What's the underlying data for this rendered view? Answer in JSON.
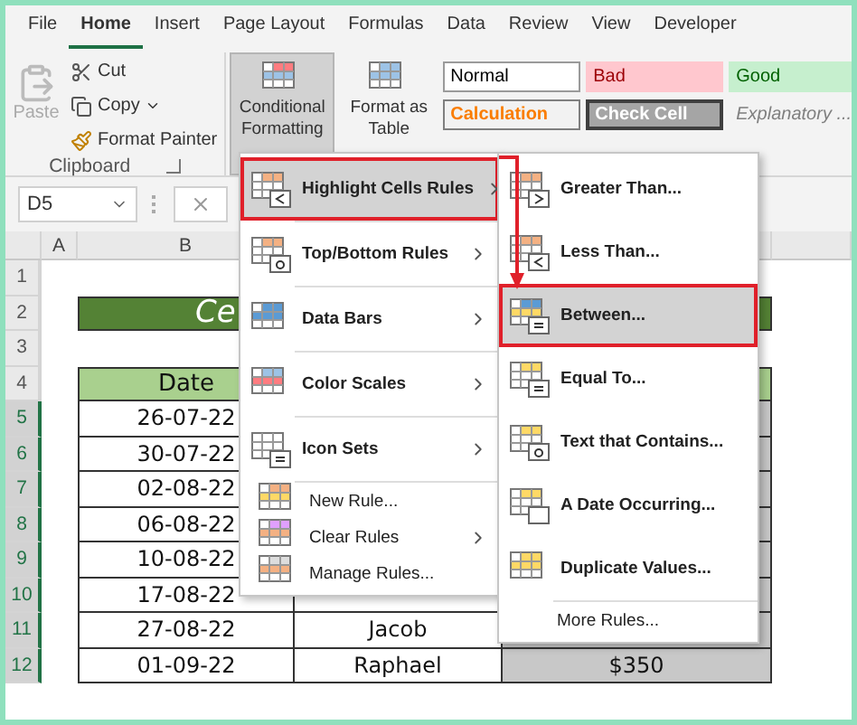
{
  "ribbon_tabs": [
    {
      "label": "File",
      "selected": false
    },
    {
      "label": "Home",
      "selected": true
    },
    {
      "label": "Insert",
      "selected": false
    },
    {
      "label": "Page Layout",
      "selected": false
    },
    {
      "label": "Formulas",
      "selected": false
    },
    {
      "label": "Data",
      "selected": false
    },
    {
      "label": "Review",
      "selected": false
    },
    {
      "label": "View",
      "selected": false
    },
    {
      "label": "Developer",
      "selected": false
    }
  ],
  "clipboard": {
    "paste": "Paste",
    "cut": "Cut",
    "copy": "Copy",
    "format_painter": "Format Painter",
    "group_label": "Clipboard"
  },
  "conditional_formatting": {
    "label": "Conditional Formatting",
    "pressed": true
  },
  "format_as_table": {
    "label": "Format as Table"
  },
  "cell_styles": [
    {
      "label": "Normal",
      "kind": "normal"
    },
    {
      "label": "Bad",
      "kind": "bad"
    },
    {
      "label": "Good",
      "kind": "good"
    },
    {
      "label": "Calculation",
      "kind": "calculation"
    },
    {
      "label": "Check Cell",
      "kind": "check"
    },
    {
      "label": "Explanatory ...",
      "kind": "explanatory"
    }
  ],
  "name_box": "D5",
  "sheet": {
    "columns": [
      "A",
      "B"
    ],
    "rows": [
      {
        "number": "1",
        "kind": "blank",
        "selected": false
      },
      {
        "number": "2",
        "kind": "title",
        "selected": false,
        "b": "Ce"
      },
      {
        "number": "3",
        "kind": "blank",
        "selected": false
      },
      {
        "number": "4",
        "kind": "header",
        "selected": false,
        "b": "Date"
      },
      {
        "number": "5",
        "kind": "data",
        "selected": true,
        "b": "26-07-22"
      },
      {
        "number": "6",
        "kind": "data",
        "selected": true,
        "b": "30-07-22"
      },
      {
        "number": "7",
        "kind": "data",
        "selected": true,
        "b": "02-08-22"
      },
      {
        "number": "8",
        "kind": "data",
        "selected": true,
        "b": "06-08-22"
      },
      {
        "number": "9",
        "kind": "data",
        "selected": true,
        "b": "10-08-22"
      },
      {
        "number": "10",
        "kind": "data",
        "selected": true,
        "b": "17-08-22"
      },
      {
        "number": "11",
        "kind": "data",
        "selected": true,
        "b": "27-08-22",
        "c": "Jacob"
      },
      {
        "number": "12",
        "kind": "data",
        "selected": true,
        "b": "01-09-22",
        "c": "Raphael",
        "d": "$350"
      }
    ]
  },
  "menu": {
    "items": [
      {
        "label": "Highlight Cells Rules",
        "kind": "large",
        "submenu": true,
        "selected": true
      },
      {
        "label": "Top/Bottom Rules",
        "kind": "large",
        "submenu": true,
        "selected": false
      },
      {
        "label": "Data Bars",
        "kind": "large",
        "submenu": true,
        "selected": false
      },
      {
        "label": "Color Scales",
        "kind": "large",
        "submenu": true,
        "selected": false
      },
      {
        "label": "Icon Sets",
        "kind": "large",
        "submenu": true,
        "selected": false
      },
      {
        "label": "New Rule...",
        "kind": "small",
        "submenu": false,
        "selected": false
      },
      {
        "label": "Clear Rules",
        "kind": "small",
        "submenu": true,
        "selected": false
      },
      {
        "label": "Manage Rules...",
        "kind": "small",
        "submenu": false,
        "selected": false
      }
    ]
  },
  "submenu": {
    "items": [
      {
        "label": "Greater Than...",
        "selected": false
      },
      {
        "label": "Less Than...",
        "selected": false
      },
      {
        "label": "Between...",
        "selected": true
      },
      {
        "label": "Equal To...",
        "selected": false
      },
      {
        "label": "Text that Contains...",
        "selected": false
      },
      {
        "label": "A Date Occurring...",
        "selected": false
      },
      {
        "label": "Duplicate Values...",
        "selected": false
      }
    ],
    "more": "More Rules..."
  }
}
